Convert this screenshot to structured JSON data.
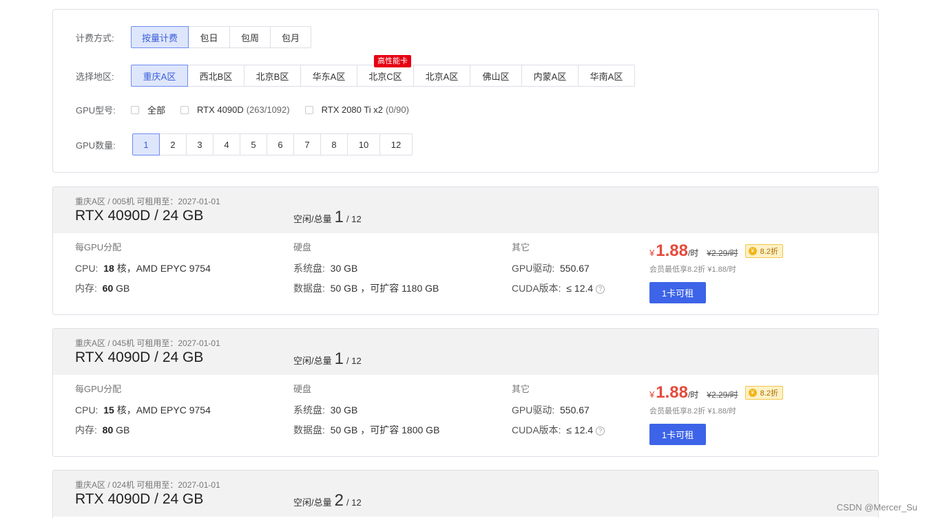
{
  "filters": {
    "billing": {
      "label": "计费方式:",
      "options": [
        "按量计费",
        "包日",
        "包周",
        "包月"
      ],
      "selected": 0
    },
    "region": {
      "label": "选择地区:",
      "options": [
        "重庆A区",
        "西北B区",
        "北京B区",
        "华东A区",
        "北京C区",
        "北京A区",
        "佛山区",
        "内蒙A区",
        "华南A区"
      ],
      "selected": 0,
      "badge": "高性能卡"
    },
    "gpu_type": {
      "label": "GPU型号:",
      "options": [
        {
          "name": "全部",
          "count": ""
        },
        {
          "name": "RTX 4090D",
          "count": "(263/1092)"
        },
        {
          "name": "RTX 2080 Ti x2",
          "count": "(0/90)"
        }
      ]
    },
    "gpu_count": {
      "label": "GPU数量:",
      "options": [
        "1",
        "2",
        "3",
        "4",
        "5",
        "6",
        "7",
        "8",
        "10",
        "12"
      ],
      "selected": 0
    }
  },
  "machines": [
    {
      "meta": "重庆A区 / 005机   可租用至：2027-01-01",
      "model": "RTX 4090D / 24 GB",
      "idle_label": "空闲/总量",
      "idle": "1",
      "total": "/ 12",
      "alloc_title": "每GPU分配",
      "cpu_label": "CPU:",
      "cpu_cores": "18",
      "cpu_rest": "核，AMD EPYC 9754",
      "mem_label": "内存:",
      "mem_val": "60",
      "mem_unit": "GB",
      "disk_title": "硬盘",
      "sys_disk_label": "系统盘:",
      "sys_disk": "30 GB",
      "data_disk_label": "数据盘:",
      "data_disk": "50 GB ，可扩容 1180 GB",
      "other_title": "其它",
      "driver_label": "GPU驱动:",
      "driver": "550.67",
      "cuda_label": "CUDA版本:",
      "cuda": "≤ 12.4",
      "yen": "¥",
      "price": "1.88",
      "unit": "/时",
      "orig_price": "¥2.29/时",
      "discount": "8.2折",
      "member": "会员最低享8.2折 ¥1.88/时",
      "rent_label": "1卡可租"
    },
    {
      "meta": "重庆A区 / 045机   可租用至：2027-01-01",
      "model": "RTX 4090D / 24 GB",
      "idle_label": "空闲/总量",
      "idle": "1",
      "total": "/ 12",
      "alloc_title": "每GPU分配",
      "cpu_label": "CPU:",
      "cpu_cores": "15",
      "cpu_rest": "核，AMD EPYC 9754",
      "mem_label": "内存:",
      "mem_val": "80",
      "mem_unit": "GB",
      "disk_title": "硬盘",
      "sys_disk_label": "系统盘:",
      "sys_disk": "30 GB",
      "data_disk_label": "数据盘:",
      "data_disk": "50 GB ，可扩容 1800 GB",
      "other_title": "其它",
      "driver_label": "GPU驱动:",
      "driver": "550.67",
      "cuda_label": "CUDA版本:",
      "cuda": "≤ 12.4",
      "yen": "¥",
      "price": "1.88",
      "unit": "/时",
      "orig_price": "¥2.29/时",
      "discount": "8.2折",
      "member": "会员最低享8.2折 ¥1.88/时",
      "rent_label": "1卡可租"
    },
    {
      "meta": "重庆A区 / 024机   可租用至：2027-01-01",
      "model": "RTX 4090D / 24 GB",
      "idle_label": "空闲/总量",
      "idle": "2",
      "total": "/ 12"
    }
  ],
  "watermark": "CSDN @Mercer_Su"
}
